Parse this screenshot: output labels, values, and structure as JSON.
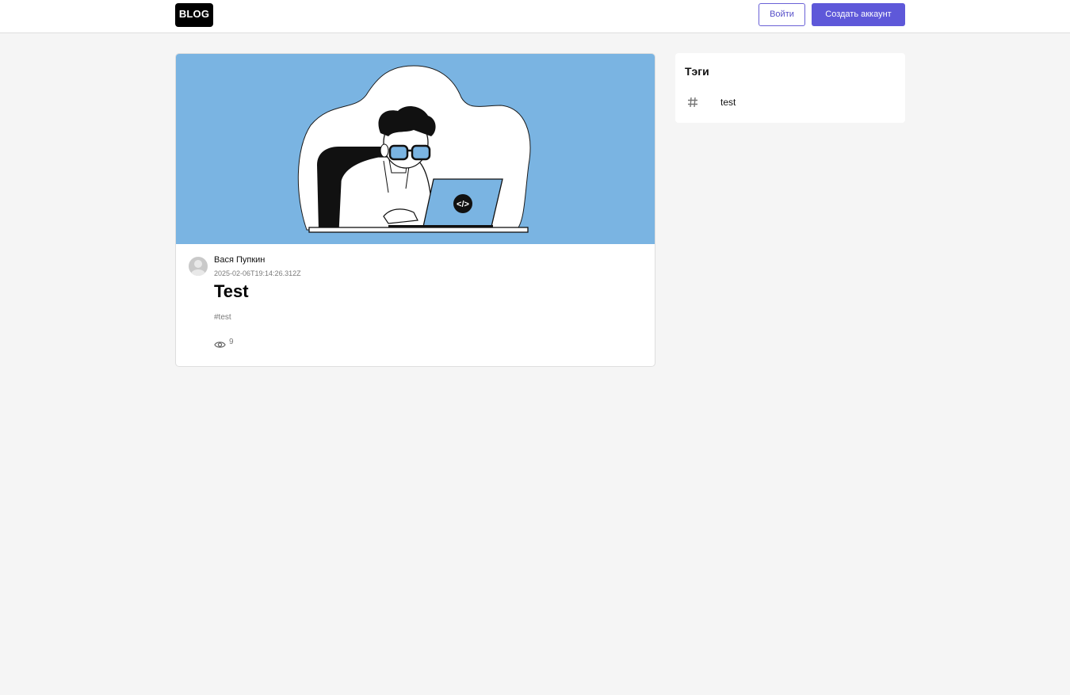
{
  "header": {
    "logo": "BLOG",
    "login_label": "Войти",
    "register_label": "Создать аккаунт"
  },
  "post": {
    "image_icon": "code-laptop-illustration",
    "code_badge": "</>",
    "author": "Вася Пупкин",
    "date": "2025-02-06T19:14:26.312Z",
    "title": "Test",
    "tag": "#test",
    "views": "9"
  },
  "sidebar": {
    "title": "Тэги",
    "tags": [
      {
        "icon": "hash-icon",
        "label": "test"
      }
    ]
  },
  "colors": {
    "accent": "#5e58d9",
    "image_bg": "#7ab4e2",
    "page_bg": "#f5f5f5"
  }
}
